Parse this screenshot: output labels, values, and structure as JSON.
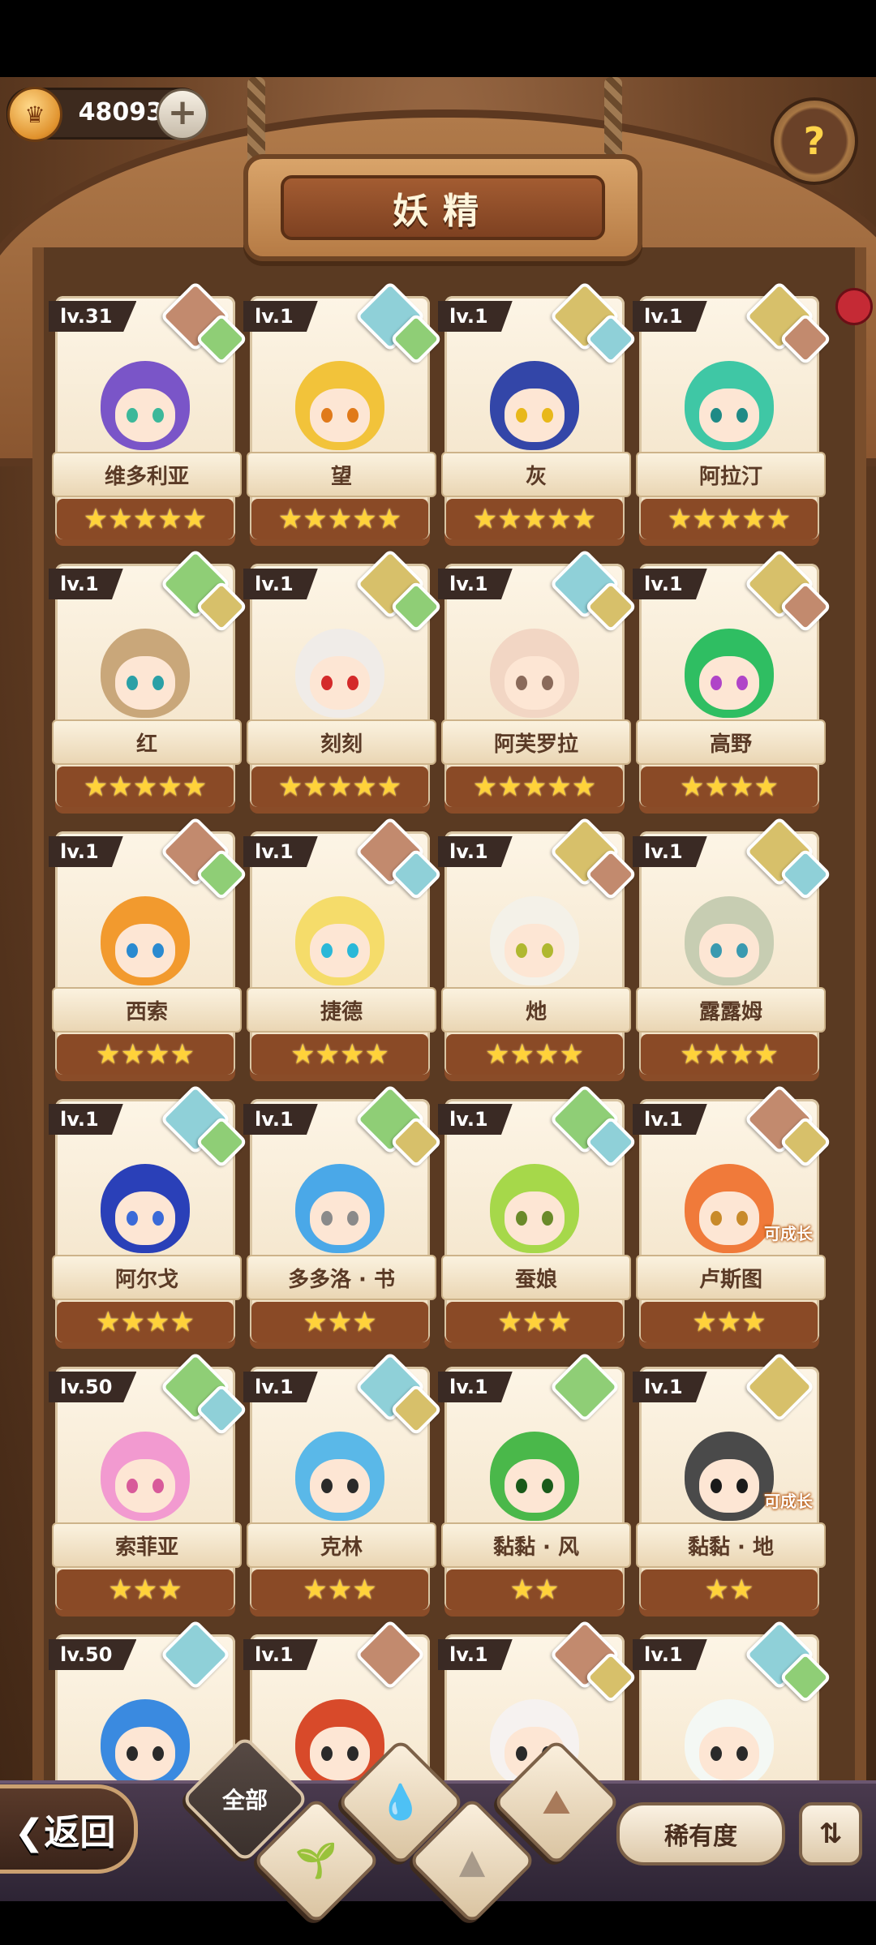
{
  "header": {
    "title": "妖精",
    "coins": "48093",
    "coin_icon": "crown-coin-icon",
    "plus_icon": "plus-icon",
    "help_icon": "help-sprout-icon"
  },
  "colors": {
    "earth": "#d7c06a",
    "water": "#8fd0d8",
    "plant": "#8fce76",
    "stone": "#c28a6e",
    "star": "#ffd23a"
  },
  "fairies": [
    {
      "level": "lv.31",
      "name": "维多利亚",
      "stars": "★★★★★",
      "elements": [
        "stone",
        "plant"
      ],
      "hair": "#7a55c8",
      "eye": "#3cb89a",
      "grow": ""
    },
    {
      "level": "lv.1",
      "name": "望",
      "stars": "★★★★★",
      "elements": [
        "water",
        "plant"
      ],
      "hair": "#f2c33a",
      "eye": "#e07a1a",
      "grow": ""
    },
    {
      "level": "lv.1",
      "name": "灰",
      "stars": "★★★★★",
      "elements": [
        "earth",
        "water"
      ],
      "hair": "#3346a8",
      "eye": "#e8b81a",
      "grow": ""
    },
    {
      "level": "lv.1",
      "name": "阿拉汀",
      "stars": "★★★★★",
      "elements": [
        "earth",
        "stone"
      ],
      "hair": "#3fc7a5",
      "eye": "#1f8a86",
      "grow": ""
    },
    {
      "level": "lv.1",
      "name": "红",
      "stars": "★★★★★",
      "elements": [
        "plant",
        "earth"
      ],
      "hair": "#c9a77a",
      "eye": "#2aa0a6",
      "grow": ""
    },
    {
      "level": "lv.1",
      "name": "刻刻",
      "stars": "★★★★★",
      "elements": [
        "earth",
        "plant"
      ],
      "hair": "#f0ece8",
      "eye": "#d42a2a",
      "grow": ""
    },
    {
      "level": "lv.1",
      "name": "阿芙罗拉",
      "stars": "★★★★★",
      "elements": [
        "water",
        "earth"
      ],
      "hair": "#f2d6c4",
      "eye": "#8a6a5a",
      "grow": ""
    },
    {
      "level": "lv.1",
      "name": "高野",
      "stars": "★★★★",
      "elements": [
        "earth",
        "stone"
      ],
      "hair": "#2fbe62",
      "eye": "#b044c8",
      "grow": ""
    },
    {
      "level": "lv.1",
      "name": "西索",
      "stars": "★★★★",
      "elements": [
        "stone",
        "plant"
      ],
      "hair": "#f29a2e",
      "eye": "#2a8ad0",
      "grow": ""
    },
    {
      "level": "lv.1",
      "name": "捷德",
      "stars": "★★★★",
      "elements": [
        "stone",
        "water"
      ],
      "hair": "#f5dc6a",
      "eye": "#2ab8d8",
      "grow": ""
    },
    {
      "level": "lv.1",
      "name": "灺",
      "stars": "★★★★",
      "elements": [
        "earth",
        "stone"
      ],
      "hair": "#f4f1e8",
      "eye": "#b0b830",
      "grow": ""
    },
    {
      "level": "lv.1",
      "name": "露露姆",
      "stars": "★★★★",
      "elements": [
        "earth",
        "water"
      ],
      "hair": "#c7cdb2",
      "eye": "#3a9ab0",
      "grow": ""
    },
    {
      "level": "lv.1",
      "name": "阿尔戈",
      "stars": "★★★★",
      "elements": [
        "water",
        "plant"
      ],
      "hair": "#2a40b8",
      "eye": "#3a6ad8",
      "grow": ""
    },
    {
      "level": "lv.1",
      "name": "多多洛 · 书",
      "stars": "★★★",
      "elements": [
        "plant",
        "earth"
      ],
      "hair": "#4aa8e8",
      "eye": "#8a8a8a",
      "grow": ""
    },
    {
      "level": "lv.1",
      "name": "蚕娘",
      "stars": "★★★",
      "elements": [
        "plant",
        "water"
      ],
      "hair": "#a6d84a",
      "eye": "#6a8a2a",
      "grow": ""
    },
    {
      "level": "lv.1",
      "name": "卢斯图",
      "stars": "★★★",
      "elements": [
        "stone",
        "earth"
      ],
      "hair": "#f07a3a",
      "eye": "#c88a2a",
      "grow": "可成长"
    },
    {
      "level": "lv.50",
      "name": "索菲亚",
      "stars": "★★★",
      "elements": [
        "plant",
        "water"
      ],
      "hair": "#f29ad0",
      "eye": "#d85a9a",
      "grow": ""
    },
    {
      "level": "lv.1",
      "name": "克林",
      "stars": "★★★",
      "elements": [
        "water",
        "earth"
      ],
      "hair": "#5ab8e8",
      "eye": "#2a2a2a",
      "grow": ""
    },
    {
      "level": "lv.1",
      "name": "黏黏 · 风",
      "stars": "★★",
      "elements": [
        "plant"
      ],
      "hair": "#4ab84a",
      "eye": "#1a5a1a",
      "grow": ""
    },
    {
      "level": "lv.1",
      "name": "黏黏 · 地",
      "stars": "★★",
      "elements": [
        "earth"
      ],
      "hair": "#4a4a4a",
      "eye": "#1a1a1a",
      "grow": "可成长"
    },
    {
      "level": "lv.50",
      "name": "",
      "stars": "",
      "elements": [
        "water"
      ],
      "hair": "#3a8ae0",
      "eye": "#2a2a2a",
      "grow": ""
    },
    {
      "level": "lv.1",
      "name": "",
      "stars": "",
      "elements": [
        "stone"
      ],
      "hair": "#d84a2a",
      "eye": "#2a2a2a",
      "grow": ""
    },
    {
      "level": "lv.1",
      "name": "",
      "stars": "",
      "elements": [
        "stone",
        "earth"
      ],
      "hair": "#f6f2f0",
      "eye": "#2a2a2a",
      "grow": ""
    },
    {
      "level": "lv.1",
      "name": "",
      "stars": "",
      "elements": [
        "water",
        "plant"
      ],
      "hair": "#f4f8f4",
      "eye": "#2a2a2a",
      "grow": ""
    }
  ],
  "bottom": {
    "back_label": "❮返回",
    "filter_all_label": "全部",
    "filter_icons": [
      "water-drop-icon",
      "plant-sprout-icon",
      "mountain-icon",
      "fire-mountain-icon"
    ],
    "rarity_label": "稀有度",
    "sort_icon": "sort-icon"
  }
}
